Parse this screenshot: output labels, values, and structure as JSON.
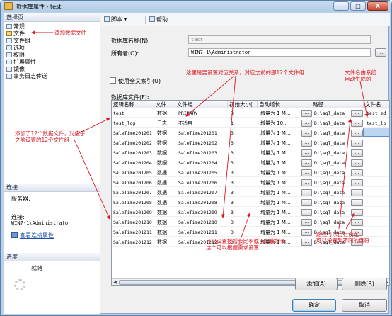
{
  "window": {
    "title": "数据库属性 - test",
    "controls": [
      "_",
      "□",
      "X"
    ]
  },
  "left": {
    "select_page": {
      "header": "选择页"
    },
    "pages": [
      "常规",
      "文件",
      "文件组",
      "选项",
      "权限",
      "扩展属性",
      "镜像",
      "事务日志传送"
    ],
    "connection": {
      "header": "连接",
      "server_label": "服务器:",
      "server_value": "",
      "connection_label": "连接:",
      "connection_value": "WIN7-1\\Administrator",
      "view_link": "查看连接属性"
    },
    "progress": {
      "header": "进度",
      "status": "就绪"
    }
  },
  "toolbar": {
    "script_label": "脚本",
    "help_label": "帮助"
  },
  "form": {
    "db_name_label": "数据库名称(N):",
    "db_name_value": "test",
    "owner_label": "所有者(O):",
    "owner_value": "WIN7-1\\Administrator",
    "ellipsis": "...",
    "fulltext_label": "使用全文索引(U)",
    "db_files_label": "数据库文件(F):"
  },
  "grid": {
    "headers": [
      "逻辑名称",
      "文件...",
      "文件组",
      "初始大小(...",
      "自动增长",
      "路径",
      "文件名"
    ],
    "rows": [
      {
        "name": "test",
        "type": "数据",
        "group": "PRIMARY",
        "size": "3",
        "growth": "增量为 1 M...",
        "path": "D:\\sql_data",
        "file": "test.md"
      },
      {
        "name": "test_log",
        "type": "日志",
        "group": "不适用",
        "size": "1",
        "growth": "增量为 10...",
        "path": "D:\\sql_data",
        "file": "test_lo"
      },
      {
        "name": "SaleTime201201",
        "type": "数据",
        "group": "SaleTime201201",
        "size": "3",
        "growth": "增量为 1 M...",
        "path": "D:\\sql_data",
        "file": ""
      },
      {
        "name": "SaleTime201202",
        "type": "数据",
        "group": "SaleTime201202",
        "size": "3",
        "growth": "增量为 1 M...",
        "path": "D:\\sql_data",
        "file": ""
      },
      {
        "name": "SaleTime201203",
        "type": "数据",
        "group": "SaleTime201203",
        "size": "3",
        "growth": "增量为 1 M...",
        "path": "D:\\sql_data",
        "file": ""
      },
      {
        "name": "SaleTime201204",
        "type": "数据",
        "group": "SaleTime201204",
        "size": "3",
        "growth": "增量为 1 M...",
        "path": "D:\\sql_data",
        "file": ""
      },
      {
        "name": "SaleTime201205",
        "type": "数据",
        "group": "SaleTime201205",
        "size": "3",
        "growth": "增量为 1 M...",
        "path": "D:\\sql_data",
        "file": ""
      },
      {
        "name": "SaleTime201206",
        "type": "数据",
        "group": "SaleTime201206",
        "size": "3",
        "growth": "增量为 1 M...",
        "path": "D:\\sql_data",
        "file": ""
      },
      {
        "name": "SaleTime201207",
        "type": "数据",
        "group": "SaleTime201207",
        "size": "3",
        "growth": "增量为 1 M...",
        "path": "D:\\sql_data",
        "file": ""
      },
      {
        "name": "SaleTime201208",
        "type": "数据",
        "group": "SaleTime201208",
        "size": "3",
        "growth": "增量为 1 M...",
        "path": "D:\\sql_data",
        "file": ""
      },
      {
        "name": "SaleTime201209",
        "type": "数据",
        "group": "SaleTime201209",
        "size": "3",
        "growth": "增量为 1 M...",
        "path": "D:\\sql_data",
        "file": ""
      },
      {
        "name": "SaleTime201210",
        "type": "数据",
        "group": "SaleTime201210",
        "size": "3",
        "growth": "增量为 1 M...",
        "path": "D:\\sql_data",
        "file": ""
      },
      {
        "name": "SaleTime201211",
        "type": "数据",
        "group": "SaleTime201211",
        "size": "3",
        "growth": "增量为 1 M...",
        "path": "D:\\sql_data",
        "file": ""
      },
      {
        "name": "SaleTime201212",
        "type": "数据",
        "group": "SaleTime201212",
        "size": "3",
        "growth": "增量为 1 M...",
        "path": "D:\\sql_data",
        "file": ""
      }
    ]
  },
  "buttons": {
    "add": "添加(A)",
    "remove": "删除(R)",
    "ok": "确定",
    "cancel": "取消"
  },
  "annotations": {
    "add_file": "添加数据文件",
    "filegroup": "这里是要设置对应关系，对应之前的那12个文件组",
    "filename": [
      "文件名由系统",
      "自动生成的"
    ],
    "added": [
      "添加了12个数据文件，对应于",
      "之前设置的12个文件组"
    ],
    "growth": [
      "可以设置按增长比率或百分比增长",
      "这个可以根据需求设置"
    ],
    "path": [
      "路径可以自行设定",
      "可以设置到不同的盘符"
    ]
  },
  "colors": {
    "annotation": "#e0141d",
    "window_frame": "#b9d1ea",
    "selection": "#bcd6f2"
  }
}
